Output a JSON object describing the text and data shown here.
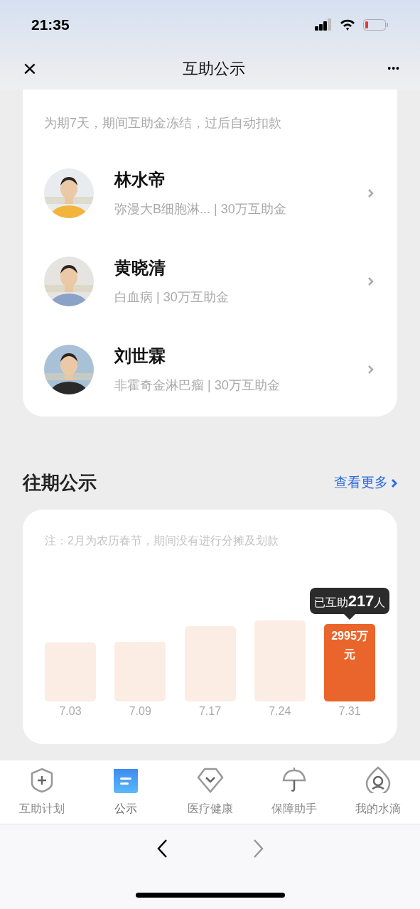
{
  "status_bar": {
    "time": "21:35"
  },
  "nav": {
    "title": "互助公示",
    "close": "×",
    "more": "•••"
  },
  "current": {
    "note": "为期7天，期间互助金冻结，过后自动扣款",
    "members": [
      {
        "name": "林水帝",
        "detail": "弥漫大B细胞淋... | 30万互助金"
      },
      {
        "name": "黄晓清",
        "detail": "白血病 | 30万互助金"
      },
      {
        "name": "刘世霖",
        "detail": "非霍奇金淋巴瘤 | 30万互助金"
      }
    ]
  },
  "past": {
    "title": "往期公示",
    "more_link": "查看更多",
    "note": "注：2月为农历春节，期间没有进行分摊及划款",
    "bars": [
      {
        "label": "7.03",
        "selected": false
      },
      {
        "label": "7.09",
        "selected": false
      },
      {
        "label": "7.17",
        "selected": false
      },
      {
        "label": "7.24",
        "selected": false
      },
      {
        "label": "7.31",
        "selected": true,
        "amount": "2995万元",
        "tooltip": "已互助**217**人"
      }
    ]
  },
  "tabs": [
    {
      "label": "互助计划",
      "selected": false,
      "kind": "shield"
    },
    {
      "label": "公示",
      "selected": true,
      "kind": "notice"
    },
    {
      "label": "医疗健康",
      "selected": false,
      "kind": "diamond"
    },
    {
      "label": "保障助手",
      "selected": false,
      "kind": "umbrella"
    },
    {
      "label": "我的水滴",
      "selected": false,
      "kind": "drop"
    }
  ]
}
